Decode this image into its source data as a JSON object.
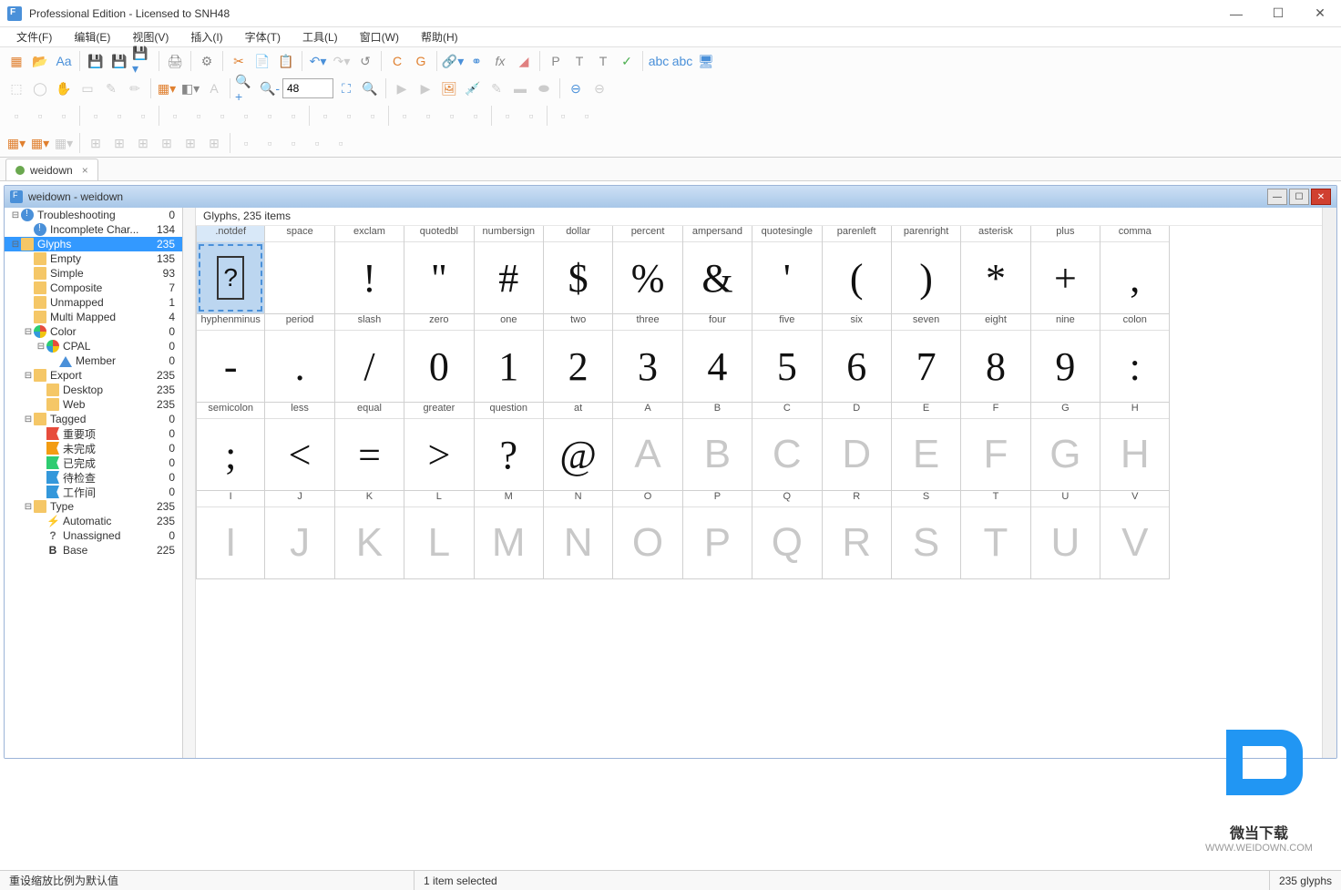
{
  "window": {
    "title": "Professional Edition - Licensed to SNH48",
    "min": "—",
    "max": "☐",
    "close": "✕"
  },
  "menu": [
    "文件(F)",
    "编辑(E)",
    "视图(V)",
    "插入(I)",
    "字体(T)",
    "工具(L)",
    "窗口(W)",
    "帮助(H)"
  ],
  "zoom_value": "48",
  "doctab": {
    "label": "weidown",
    "close": "×"
  },
  "inner_title": "weidown - weidown",
  "tree": [
    {
      "ind": 1,
      "tog": "⊟",
      "ico": "ic-info",
      "lbl": "Troubleshooting",
      "cnt": "0"
    },
    {
      "ind": 2,
      "tog": "",
      "ico": "ic-info",
      "lbl": "Incomplete Char...",
      "cnt": "134"
    },
    {
      "ind": 1,
      "tog": "⊟",
      "ico": "ic-folder",
      "lbl": "Glyphs",
      "cnt": "235",
      "sel": true
    },
    {
      "ind": 2,
      "tog": "",
      "ico": "ic-folder",
      "lbl": "Empty",
      "cnt": "135"
    },
    {
      "ind": 2,
      "tog": "",
      "ico": "ic-folder",
      "lbl": "Simple",
      "cnt": "93"
    },
    {
      "ind": 2,
      "tog": "",
      "ico": "ic-folder",
      "lbl": "Composite",
      "cnt": "7"
    },
    {
      "ind": 2,
      "tog": "",
      "ico": "ic-folder",
      "lbl": "Unmapped",
      "cnt": "1"
    },
    {
      "ind": 2,
      "tog": "",
      "ico": "ic-folder",
      "lbl": "Multi Mapped",
      "cnt": "4"
    },
    {
      "ind": 2,
      "tog": "⊟",
      "ico": "ic-pie",
      "lbl": "Color",
      "cnt": "0"
    },
    {
      "ind": 3,
      "tog": "⊟",
      "ico": "ic-pie",
      "lbl": "CPAL",
      "cnt": "0"
    },
    {
      "ind": 4,
      "tog": "",
      "ico": "ic-tri",
      "lbl": "Member",
      "cnt": "0"
    },
    {
      "ind": 2,
      "tog": "⊟",
      "ico": "ic-folder",
      "lbl": "Export",
      "cnt": "235"
    },
    {
      "ind": 3,
      "tog": "",
      "ico": "ic-folder",
      "lbl": "Desktop",
      "cnt": "235"
    },
    {
      "ind": 3,
      "tog": "",
      "ico": "ic-folder",
      "lbl": "Web",
      "cnt": "235"
    },
    {
      "ind": 2,
      "tog": "⊟",
      "ico": "ic-folder",
      "lbl": "Tagged",
      "cnt": "0"
    },
    {
      "ind": 3,
      "tog": "",
      "ico": "ic-flag-r",
      "lbl": "重要项",
      "cnt": "0"
    },
    {
      "ind": 3,
      "tog": "",
      "ico": "ic-flag-o",
      "lbl": "未完成",
      "cnt": "0"
    },
    {
      "ind": 3,
      "tog": "",
      "ico": "ic-flag-g",
      "lbl": "已完成",
      "cnt": "0"
    },
    {
      "ind": 3,
      "tog": "",
      "ico": "ic-flag-b",
      "lbl": "待检查",
      "cnt": "0"
    },
    {
      "ind": 3,
      "tog": "",
      "ico": "ic-flag-b",
      "lbl": "工作间",
      "cnt": "0"
    },
    {
      "ind": 2,
      "tog": "⊟",
      "ico": "ic-folder",
      "lbl": "Type",
      "cnt": "235"
    },
    {
      "ind": 3,
      "tog": "",
      "ico": "ic-bolt",
      "lbl": "Automatic",
      "cnt": "235"
    },
    {
      "ind": 3,
      "tog": "",
      "ico": "ic-q",
      "lbl": "Unassigned",
      "cnt": "0"
    },
    {
      "ind": 3,
      "tog": "",
      "ico": "ic-b",
      "lbl": "Base",
      "cnt": "225"
    }
  ],
  "glyph_header": "Glyphs, 235 items",
  "glyph_rows": [
    [
      {
        "n": ".notdef",
        "c": "?",
        "sel": true,
        "notdef": true
      },
      {
        "n": "space",
        "c": " "
      },
      {
        "n": "exclam",
        "c": "!"
      },
      {
        "n": "quotedbl",
        "c": "\""
      },
      {
        "n": "numbersign",
        "c": "#"
      },
      {
        "n": "dollar",
        "c": "$"
      },
      {
        "n": "percent",
        "c": "%"
      },
      {
        "n": "ampersand",
        "c": "&"
      },
      {
        "n": "quotesingle",
        "c": "'"
      },
      {
        "n": "parenleft",
        "c": "("
      },
      {
        "n": "parenright",
        "c": ")"
      },
      {
        "n": "asterisk",
        "c": "*"
      },
      {
        "n": "plus",
        "c": "+"
      },
      {
        "n": "comma",
        "c": ","
      }
    ],
    [
      {
        "n": "hyphenminus",
        "c": "-"
      },
      {
        "n": "period",
        "c": "."
      },
      {
        "n": "slash",
        "c": "/"
      },
      {
        "n": "zero",
        "c": "0"
      },
      {
        "n": "one",
        "c": "1"
      },
      {
        "n": "two",
        "c": "2"
      },
      {
        "n": "three",
        "c": "3"
      },
      {
        "n": "four",
        "c": "4"
      },
      {
        "n": "five",
        "c": "5"
      },
      {
        "n": "six",
        "c": "6"
      },
      {
        "n": "seven",
        "c": "7"
      },
      {
        "n": "eight",
        "c": "8"
      },
      {
        "n": "nine",
        "c": "9"
      },
      {
        "n": "colon",
        "c": ":"
      }
    ],
    [
      {
        "n": "semicolon",
        "c": ";"
      },
      {
        "n": "less",
        "c": "<"
      },
      {
        "n": "equal",
        "c": "="
      },
      {
        "n": "greater",
        "c": ">"
      },
      {
        "n": "question",
        "c": "?"
      },
      {
        "n": "at",
        "c": "@"
      },
      {
        "n": "A",
        "c": "A",
        "g": true
      },
      {
        "n": "B",
        "c": "B",
        "g": true
      },
      {
        "n": "C",
        "c": "C",
        "g": true
      },
      {
        "n": "D",
        "c": "D",
        "g": true
      },
      {
        "n": "E",
        "c": "E",
        "g": true
      },
      {
        "n": "F",
        "c": "F",
        "g": true
      },
      {
        "n": "G",
        "c": "G",
        "g": true
      },
      {
        "n": "H",
        "c": "H",
        "g": true
      }
    ],
    [
      {
        "n": "I",
        "c": "I",
        "g": true
      },
      {
        "n": "J",
        "c": "J",
        "g": true
      },
      {
        "n": "K",
        "c": "K",
        "g": true
      },
      {
        "n": "L",
        "c": "L",
        "g": true
      },
      {
        "n": "M",
        "c": "M",
        "g": true
      },
      {
        "n": "N",
        "c": "N",
        "g": true
      },
      {
        "n": "O",
        "c": "O",
        "g": true
      },
      {
        "n": "P",
        "c": "P",
        "g": true
      },
      {
        "n": "Q",
        "c": "Q",
        "g": true
      },
      {
        "n": "R",
        "c": "R",
        "g": true
      },
      {
        "n": "S",
        "c": "S",
        "g": true
      },
      {
        "n": "T",
        "c": "T",
        "g": true
      },
      {
        "n": "U",
        "c": "U",
        "g": true
      },
      {
        "n": "V",
        "c": "V",
        "g": true
      }
    ]
  ],
  "status": {
    "left": "重设缩放比例为默认值",
    "mid": "1 item selected",
    "right": "235 glyphs"
  },
  "watermark": {
    "t1": "微当下载",
    "t2": "WWW.WEIDOWN.COM"
  }
}
